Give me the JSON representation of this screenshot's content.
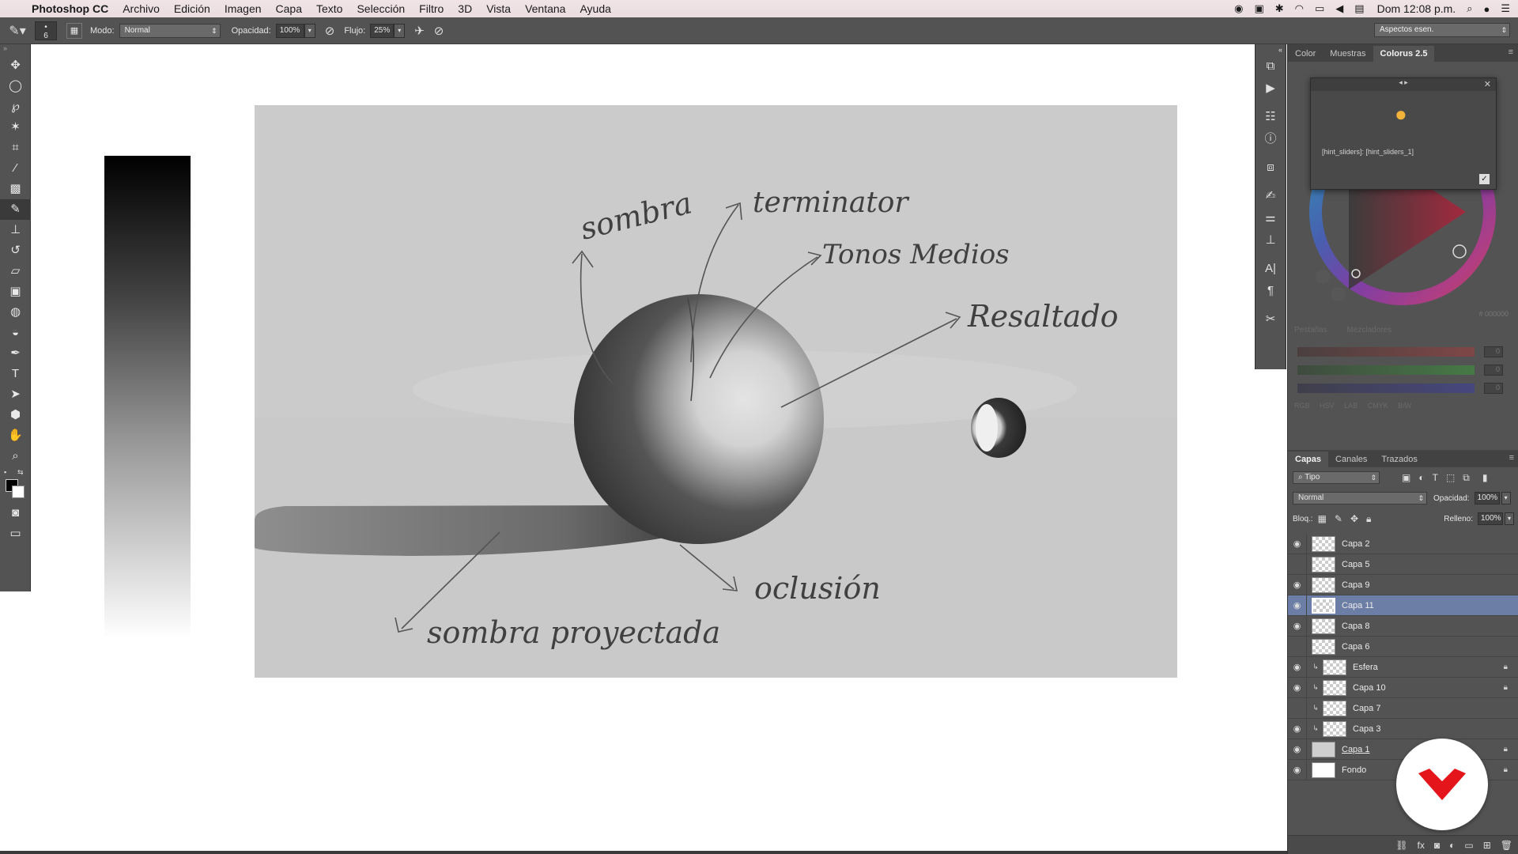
{
  "menubar": {
    "app": "Photoshop CC",
    "items": [
      "Archivo",
      "Edición",
      "Imagen",
      "Capa",
      "Texto",
      "Selección",
      "Filtro",
      "3D",
      "Vista",
      "Ventana",
      "Ayuda"
    ],
    "clock": "Dom 12:08 p.m."
  },
  "options": {
    "brush_size": "6",
    "mode_label": "Modo:",
    "mode_value": "Normal",
    "opacity_label": "Opacidad:",
    "opacity_value": "100%",
    "flow_label": "Flujo:",
    "flow_value": "25%",
    "workspace": "Aspectos esen."
  },
  "artwork": {
    "labels": {
      "sombra": "sombra",
      "terminator": "terminator",
      "tonos_medios": "Tonos Medios",
      "resaltado": "Resaltado",
      "oclusion": "oclusión",
      "sombra_proyectada": "sombra proyectada"
    }
  },
  "color_panel": {
    "tabs": [
      "Color",
      "Muestras",
      "Colorus 2.5"
    ],
    "active_tab": "Colorus 2.5",
    "hint": "[hint_sliders]: [hint_sliders_1]",
    "hex": "# 000000",
    "sub_tabs": [
      "Pestañas",
      "Mezcladores"
    ],
    "slider_values": [
      "0",
      "0",
      "0"
    ],
    "modes": [
      "RGB",
      "HSV",
      "LAB",
      "CMYK",
      "B/W"
    ]
  },
  "layers_panel": {
    "tabs": [
      "Capas",
      "Canales",
      "Trazados"
    ],
    "filter_label": "Tipo",
    "blend_mode": "Normal",
    "opacity_label": "Opacidad:",
    "opacity_value": "100%",
    "lock_label": "Bloq.:",
    "fill_label": "Relleno:",
    "fill_value": "100%",
    "layers": [
      {
        "name": "Capa 2"
      },
      {
        "name": "Capa 5"
      },
      {
        "name": "Capa 9"
      },
      {
        "name": "Capa 11"
      },
      {
        "name": "Capa 8"
      },
      {
        "name": "Capa 6"
      },
      {
        "name": "Esfera"
      },
      {
        "name": "Capa 10"
      },
      {
        "name": "Capa 7"
      },
      {
        "name": "Capa 3"
      },
      {
        "name": "Capa 1"
      },
      {
        "name": "Fondo"
      }
    ]
  },
  "colors": {
    "selected_layer": "#6d7ea6",
    "badge_red": "#e4161c",
    "panel_bg": "#535353"
  }
}
